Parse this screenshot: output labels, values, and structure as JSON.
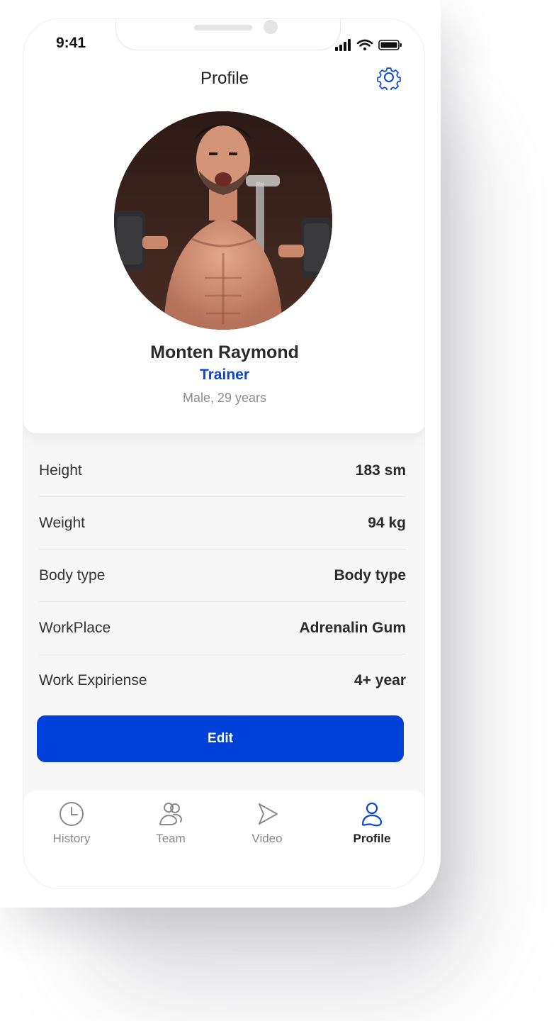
{
  "status_bar": {
    "time": "9:41"
  },
  "header": {
    "title": "Profile",
    "settings_icon": "gear-icon"
  },
  "user": {
    "name": "Monten Raymond",
    "role": "Trainer",
    "meta": "Male,  29 years"
  },
  "details": [
    {
      "label": "Height",
      "value": "183 sm"
    },
    {
      "label": "Weight",
      "value": "94 kg"
    },
    {
      "label": "Body type",
      "value": "Body type"
    },
    {
      "label": "WorkPlace",
      "value": "Adrenalin Gum"
    },
    {
      "label": "Work Expiriense",
      "value": "4+ year"
    }
  ],
  "actions": {
    "edit_label": "Edit"
  },
  "tabs": [
    {
      "label": "History",
      "icon": "clock-icon"
    },
    {
      "label": "Team",
      "icon": "team-icon"
    },
    {
      "label": "Video",
      "icon": "play-icon"
    },
    {
      "label": "Profile",
      "icon": "user-icon"
    }
  ],
  "colors": {
    "accent": "#0042d9",
    "muted": "#8a8a8a",
    "background": "#f7f7f7"
  }
}
